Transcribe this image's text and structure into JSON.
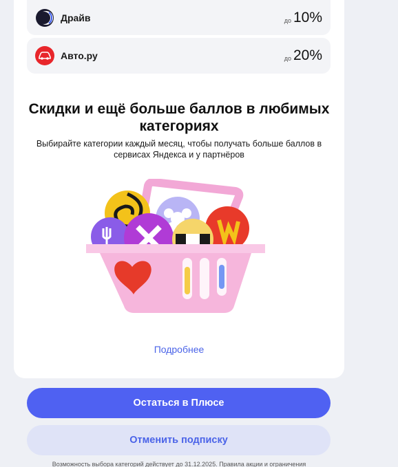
{
  "partners": [
    {
      "name": "Драйв",
      "prefix": "до",
      "value": "10%",
      "icon": "drive-logo-icon",
      "color": "#1a1a2e"
    },
    {
      "name": "Авто.ру",
      "prefix": "до",
      "value": "20%",
      "icon": "autoru-logo-icon",
      "color": "#e8262b"
    }
  ],
  "promo": {
    "title": "Скидки и ещё больше баллов в любимых категориях",
    "subtitle": "Выбирайте категории каждый месяц, чтобы получать больше баллов в сервисах Яндекса и у партнёров",
    "image_icon": "basket-with-category-balls-illustration",
    "more_link": "Подробнее"
  },
  "actions": {
    "stay_label": "Остаться в Плюсе",
    "cancel_label": "Отменить подписку"
  },
  "footnote": "Возможность выбора категорий действует до 31.12.2025. Правила акции и ограничения",
  "colors": {
    "accent": "#4f61f2",
    "link": "#4a63e8",
    "secondary_bg": "#dfe3f7"
  }
}
